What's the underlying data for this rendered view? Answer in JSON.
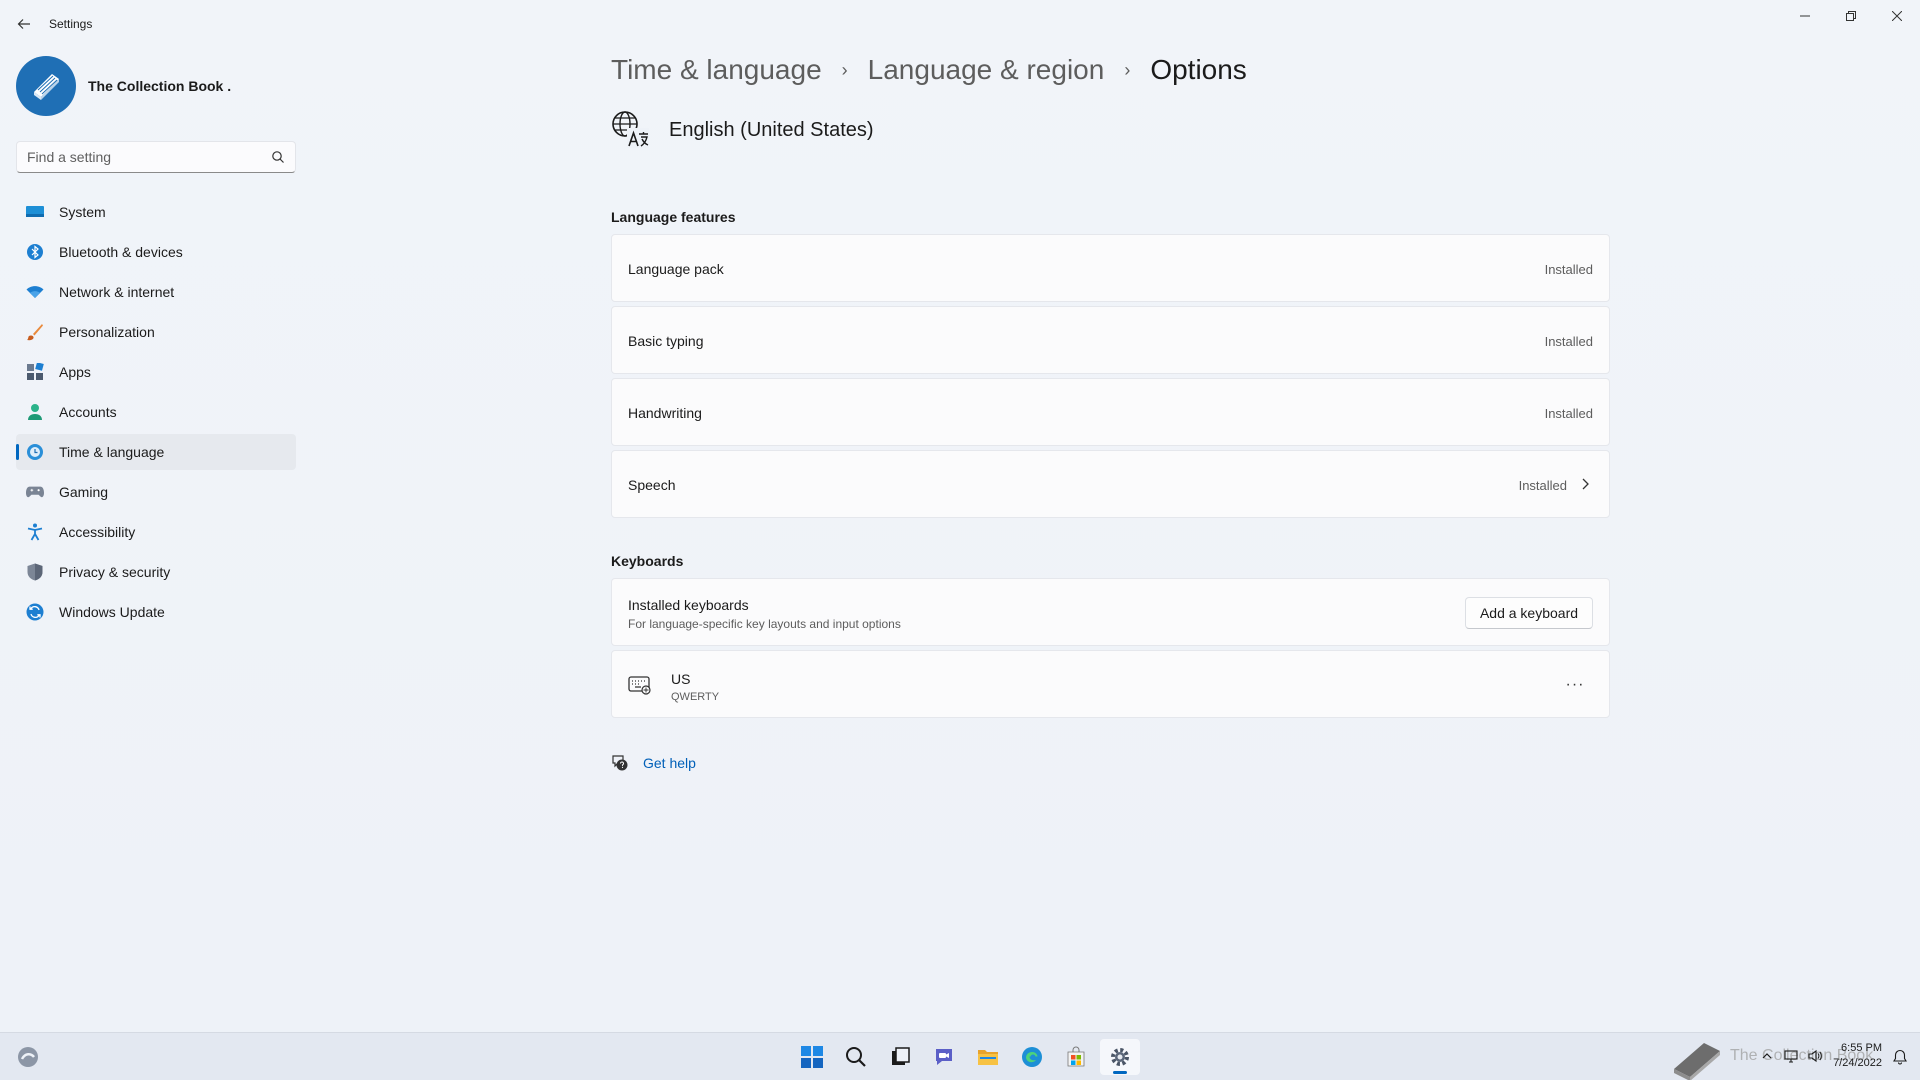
{
  "window": {
    "title": "Settings",
    "controls": {
      "minimize": "—",
      "maximize": "❐",
      "close": "✕"
    }
  },
  "profile": {
    "name": "The Collection Book ."
  },
  "search": {
    "placeholder": "Find a setting"
  },
  "sidebar": {
    "items": [
      {
        "label": "System",
        "icon": "system-icon"
      },
      {
        "label": "Bluetooth & devices",
        "icon": "bluetooth-icon"
      },
      {
        "label": "Network & internet",
        "icon": "wifi-icon"
      },
      {
        "label": "Personalization",
        "icon": "brush-icon"
      },
      {
        "label": "Apps",
        "icon": "apps-icon"
      },
      {
        "label": "Accounts",
        "icon": "person-icon"
      },
      {
        "label": "Time & language",
        "icon": "globe-clock-icon",
        "selected": true
      },
      {
        "label": "Gaming",
        "icon": "gamepad-icon"
      },
      {
        "label": "Accessibility",
        "icon": "accessibility-icon"
      },
      {
        "label": "Privacy & security",
        "icon": "shield-icon"
      },
      {
        "label": "Windows Update",
        "icon": "update-icon"
      }
    ]
  },
  "breadcrumb": {
    "items": [
      "Time & language",
      "Language & region"
    ],
    "current": "Options",
    "separator": "›"
  },
  "language": {
    "name": "English (United States)"
  },
  "features": {
    "title": "Language features",
    "items": [
      {
        "label": "Language pack",
        "status": "Installed"
      },
      {
        "label": "Basic typing",
        "status": "Installed"
      },
      {
        "label": "Handwriting",
        "status": "Installed"
      },
      {
        "label": "Speech",
        "status": "Installed"
      }
    ]
  },
  "keyboards": {
    "title": "Keyboards",
    "installed_title": "Installed keyboards",
    "installed_desc": "For language-specific key layouts and input options",
    "add_label": "Add a keyboard",
    "items": [
      {
        "name": "US",
        "layout": "QWERTY"
      }
    ],
    "more": "···"
  },
  "help": {
    "label": "Get help"
  },
  "taskbar": {
    "apps": [
      "start-icon",
      "search-icon",
      "task-view-icon",
      "chat-icon",
      "file-explorer-icon",
      "edge-icon",
      "store-icon",
      "settings-icon"
    ],
    "watermark": "The Collection Book",
    "time": "6:55 PM",
    "date": "7/24/2022"
  },
  "colors": {
    "accent": "#0067c0",
    "link": "#005fb8",
    "background": "#eef2f8",
    "card": "#fbfbfc"
  }
}
